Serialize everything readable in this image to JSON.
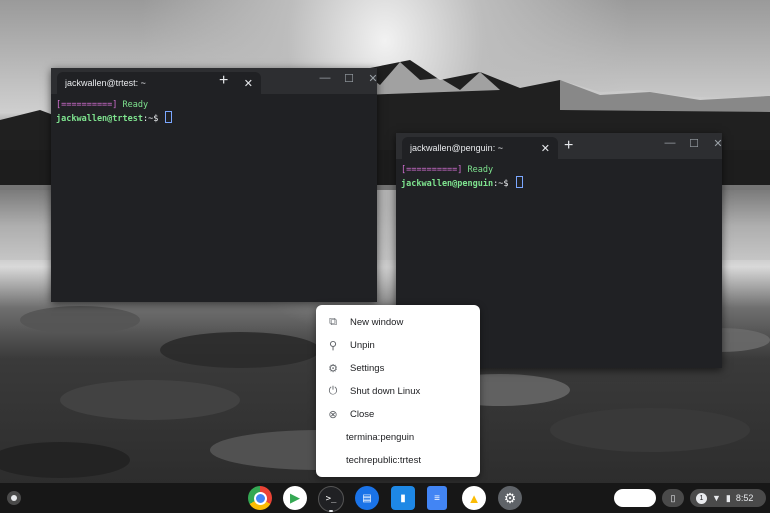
{
  "terminal_trtest": {
    "tab_title": "jackwallen@trtest: ~",
    "progress_text": "[==========]",
    "ready_text": "Ready",
    "prompt_user": "jackwallen@trtest",
    "prompt_suffix": ":~$"
  },
  "terminal_penguin": {
    "tab_title": "jackwallen@penguin: ~",
    "progress_text": "[==========]",
    "ready_text": "Ready",
    "prompt_user": "jackwallen@penguin",
    "prompt_suffix": ":~$"
  },
  "context_menu": {
    "items": [
      {
        "label": "New window",
        "icon": "new-window-icon"
      },
      {
        "label": "Unpin",
        "icon": "pin-icon"
      },
      {
        "label": "Settings",
        "icon": "gear-icon"
      },
      {
        "label": "Shut down Linux",
        "icon": "power-icon"
      },
      {
        "label": "Close",
        "icon": "close-circle-icon"
      }
    ],
    "windows": [
      "termina:penguin",
      "techrepublic:trtest"
    ]
  },
  "shelf": {
    "apps": [
      {
        "name": "chrome",
        "glyph": ""
      },
      {
        "name": "play-store",
        "glyph": "▶"
      },
      {
        "name": "terminal",
        "glyph": ">_"
      },
      {
        "name": "messages",
        "glyph": "▤"
      },
      {
        "name": "files",
        "glyph": "▮"
      },
      {
        "name": "docs",
        "glyph": "≡"
      },
      {
        "name": "drive",
        "glyph": "▲"
      },
      {
        "name": "settings",
        "glyph": "⚙"
      }
    ],
    "notification_count": "1",
    "time": "8:52"
  }
}
